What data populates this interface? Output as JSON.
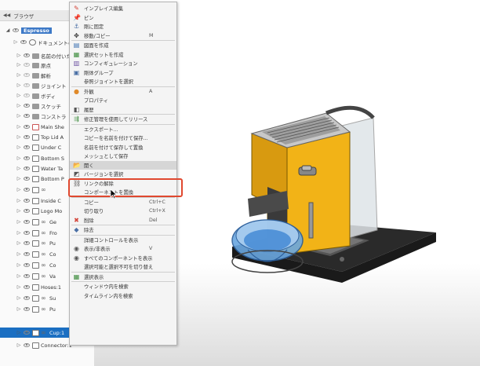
{
  "browser": {
    "title": "ブラウザ",
    "rows": [
      {
        "label": "Espresso",
        "root": true
      },
      {
        "label": "ドキュメントの設",
        "icon": "gear"
      },
      {
        "label": "名前の付いたビ",
        "icon": "folder"
      },
      {
        "label": "原点",
        "icon": "folder"
      },
      {
        "label": "解析",
        "icon": "folder"
      },
      {
        "label": "ジョイント",
        "icon": "folder"
      },
      {
        "label": "ボディ",
        "icon": "folder"
      },
      {
        "label": "スケッチ",
        "icon": "folder"
      },
      {
        "label": "コンストラ",
        "icon": "folder"
      },
      {
        "label": "Main She",
        "icon": "compdoc"
      },
      {
        "label": "Top Lid A",
        "icon": "compdoc"
      },
      {
        "label": "Under C",
        "icon": "compdoc"
      },
      {
        "label": "Bottom S",
        "icon": "compdoc"
      },
      {
        "label": "Water Ta",
        "icon": "compdoc"
      },
      {
        "label": "Bottom P",
        "icon": "compdoc"
      },
      {
        "label": "",
        "icon": "compdoc-link"
      },
      {
        "label": "Inside C",
        "icon": "compdoc"
      },
      {
        "label": "Logo Mo",
        "icon": "compdoc"
      },
      {
        "label": "Ge",
        "icon": "compdoc-link"
      },
      {
        "label": "Fro",
        "icon": "compdoc-link"
      },
      {
        "label": "Pu",
        "icon": "compdoc-link"
      },
      {
        "label": "Co",
        "icon": "compdoc-link"
      },
      {
        "label": "Co",
        "icon": "compdoc-link"
      },
      {
        "label": "Va",
        "icon": "compdoc-link"
      },
      {
        "label": "Hoses:1",
        "icon": "compdoc"
      },
      {
        "label": "Su",
        "icon": "compdoc-link"
      },
      {
        "label": "Pu",
        "icon": "compdoc-link"
      },
      {
        "label": "Cup:1",
        "icon": "compdoc-link",
        "selected": true
      },
      {
        "label": "Connector:1",
        "icon": "compdoc"
      }
    ]
  },
  "menu": {
    "items": [
      {
        "label": "インプレイス編集",
        "icon": "pencil-icon",
        "glyph": "✎",
        "color": "#d4453a"
      },
      {
        "label": "ピン",
        "icon": "pin-icon",
        "glyph": "📌",
        "color": "#d4453a"
      },
      {
        "label": "剛に固定",
        "icon": "anchor-icon",
        "glyph": "⚓",
        "color": "#4a6fa5"
      },
      {
        "label": "移動/コピー",
        "icon": "move-icon",
        "glyph": "✥",
        "color": "#333",
        "shortcut": "M"
      },
      {
        "sep": true
      },
      {
        "label": "図面を作成",
        "icon": "drawing-icon",
        "glyph": "▤",
        "color": "#3a6fb0"
      },
      {
        "label": "選択セットを作成",
        "icon": "selection-set-icon",
        "glyph": "▦",
        "color": "#3a8a3a"
      },
      {
        "label": "コンフィギュレーション",
        "icon": "configuration-icon",
        "glyph": "▥",
        "color": "#6a4fa0"
      },
      {
        "label": "剛体グループ",
        "icon": "rigid-group-icon",
        "glyph": "▣",
        "color": "#4a6fa5"
      },
      {
        "label": "参照ジョイントを選択",
        "icon": "",
        "glyph": "",
        "color": "#333"
      },
      {
        "sep": true
      },
      {
        "label": "外観",
        "icon": "appearance-icon",
        "glyph": "●",
        "color": "#e08a2a",
        "shortcut": "A"
      },
      {
        "label": "プロパティ",
        "icon": "",
        "glyph": "",
        "color": "#333"
      },
      {
        "label": "履歴",
        "icon": "history-icon",
        "glyph": "◧",
        "color": "#555"
      },
      {
        "sep": true
      },
      {
        "label": "修正管理を使用してリリース",
        "icon": "release-icon",
        "glyph": "⇶",
        "color": "#3a8a3a"
      },
      {
        "sep": true
      },
      {
        "label": "エクスポート...",
        "icon": "",
        "glyph": "",
        "color": "#333"
      },
      {
        "label": "コピーを名前を付けて保存...",
        "icon": "",
        "glyph": "",
        "color": "#333"
      },
      {
        "label": "名前を付けて保存して置換",
        "icon": "",
        "glyph": "",
        "color": "#333"
      },
      {
        "label": "メッシュとして保存",
        "icon": "",
        "glyph": "",
        "color": "#333"
      },
      {
        "label": "開く",
        "icon": "open-icon",
        "glyph": "📂",
        "color": "#555",
        "highlighted": true
      },
      {
        "label": "バージョンを選択",
        "icon": "version-icon",
        "glyph": "◩",
        "color": "#555"
      },
      {
        "label": "リンクの解除",
        "icon": "unlink-icon",
        "glyph": "⛓",
        "color": "#555"
      },
      {
        "label": "コンポーネントを置換",
        "icon": "",
        "glyph": "",
        "color": "#333"
      },
      {
        "sep": true
      },
      {
        "label": "コピー",
        "icon": "",
        "glyph": "",
        "color": "#333",
        "shortcut": "Ctrl+C"
      },
      {
        "label": "切り取り",
        "icon": "",
        "glyph": "",
        "color": "#333",
        "shortcut": "Ctrl+X"
      },
      {
        "label": "削除",
        "icon": "delete-icon",
        "glyph": "✖",
        "color": "#d4453a",
        "shortcut": "Del"
      },
      {
        "sep": true
      },
      {
        "label": "除去",
        "icon": "remove-icon",
        "glyph": "◆",
        "color": "#4a6fa5"
      },
      {
        "sep": true
      },
      {
        "label": "詳細コントロールを表示",
        "icon": "",
        "glyph": "",
        "color": "#333"
      },
      {
        "label": "表示/非表示",
        "icon": "eye-icon",
        "glyph": "◉",
        "color": "#555",
        "shortcut": "V"
      },
      {
        "label": "すべてのコンポーネントを表示",
        "icon": "show-all-icon",
        "glyph": "◉",
        "color": "#555"
      },
      {
        "label": "選択可能と選択不可を切り替え",
        "icon": "",
        "glyph": "",
        "color": "#333"
      },
      {
        "sep": true
      },
      {
        "label": "選択表示",
        "icon": "isolate-icon",
        "glyph": "▦",
        "color": "#3a8a3a"
      },
      {
        "sep": true
      },
      {
        "label": "ウィンドウ内を検索",
        "icon": "",
        "glyph": "",
        "color": "#333"
      },
      {
        "label": "タイムライン内を検索",
        "icon": "",
        "glyph": "",
        "color": "#333"
      }
    ]
  },
  "colors": {
    "body_yellow": "#f2b317",
    "highlight_outline": "#e0482f",
    "selection_blue": "#1b6fc2"
  }
}
